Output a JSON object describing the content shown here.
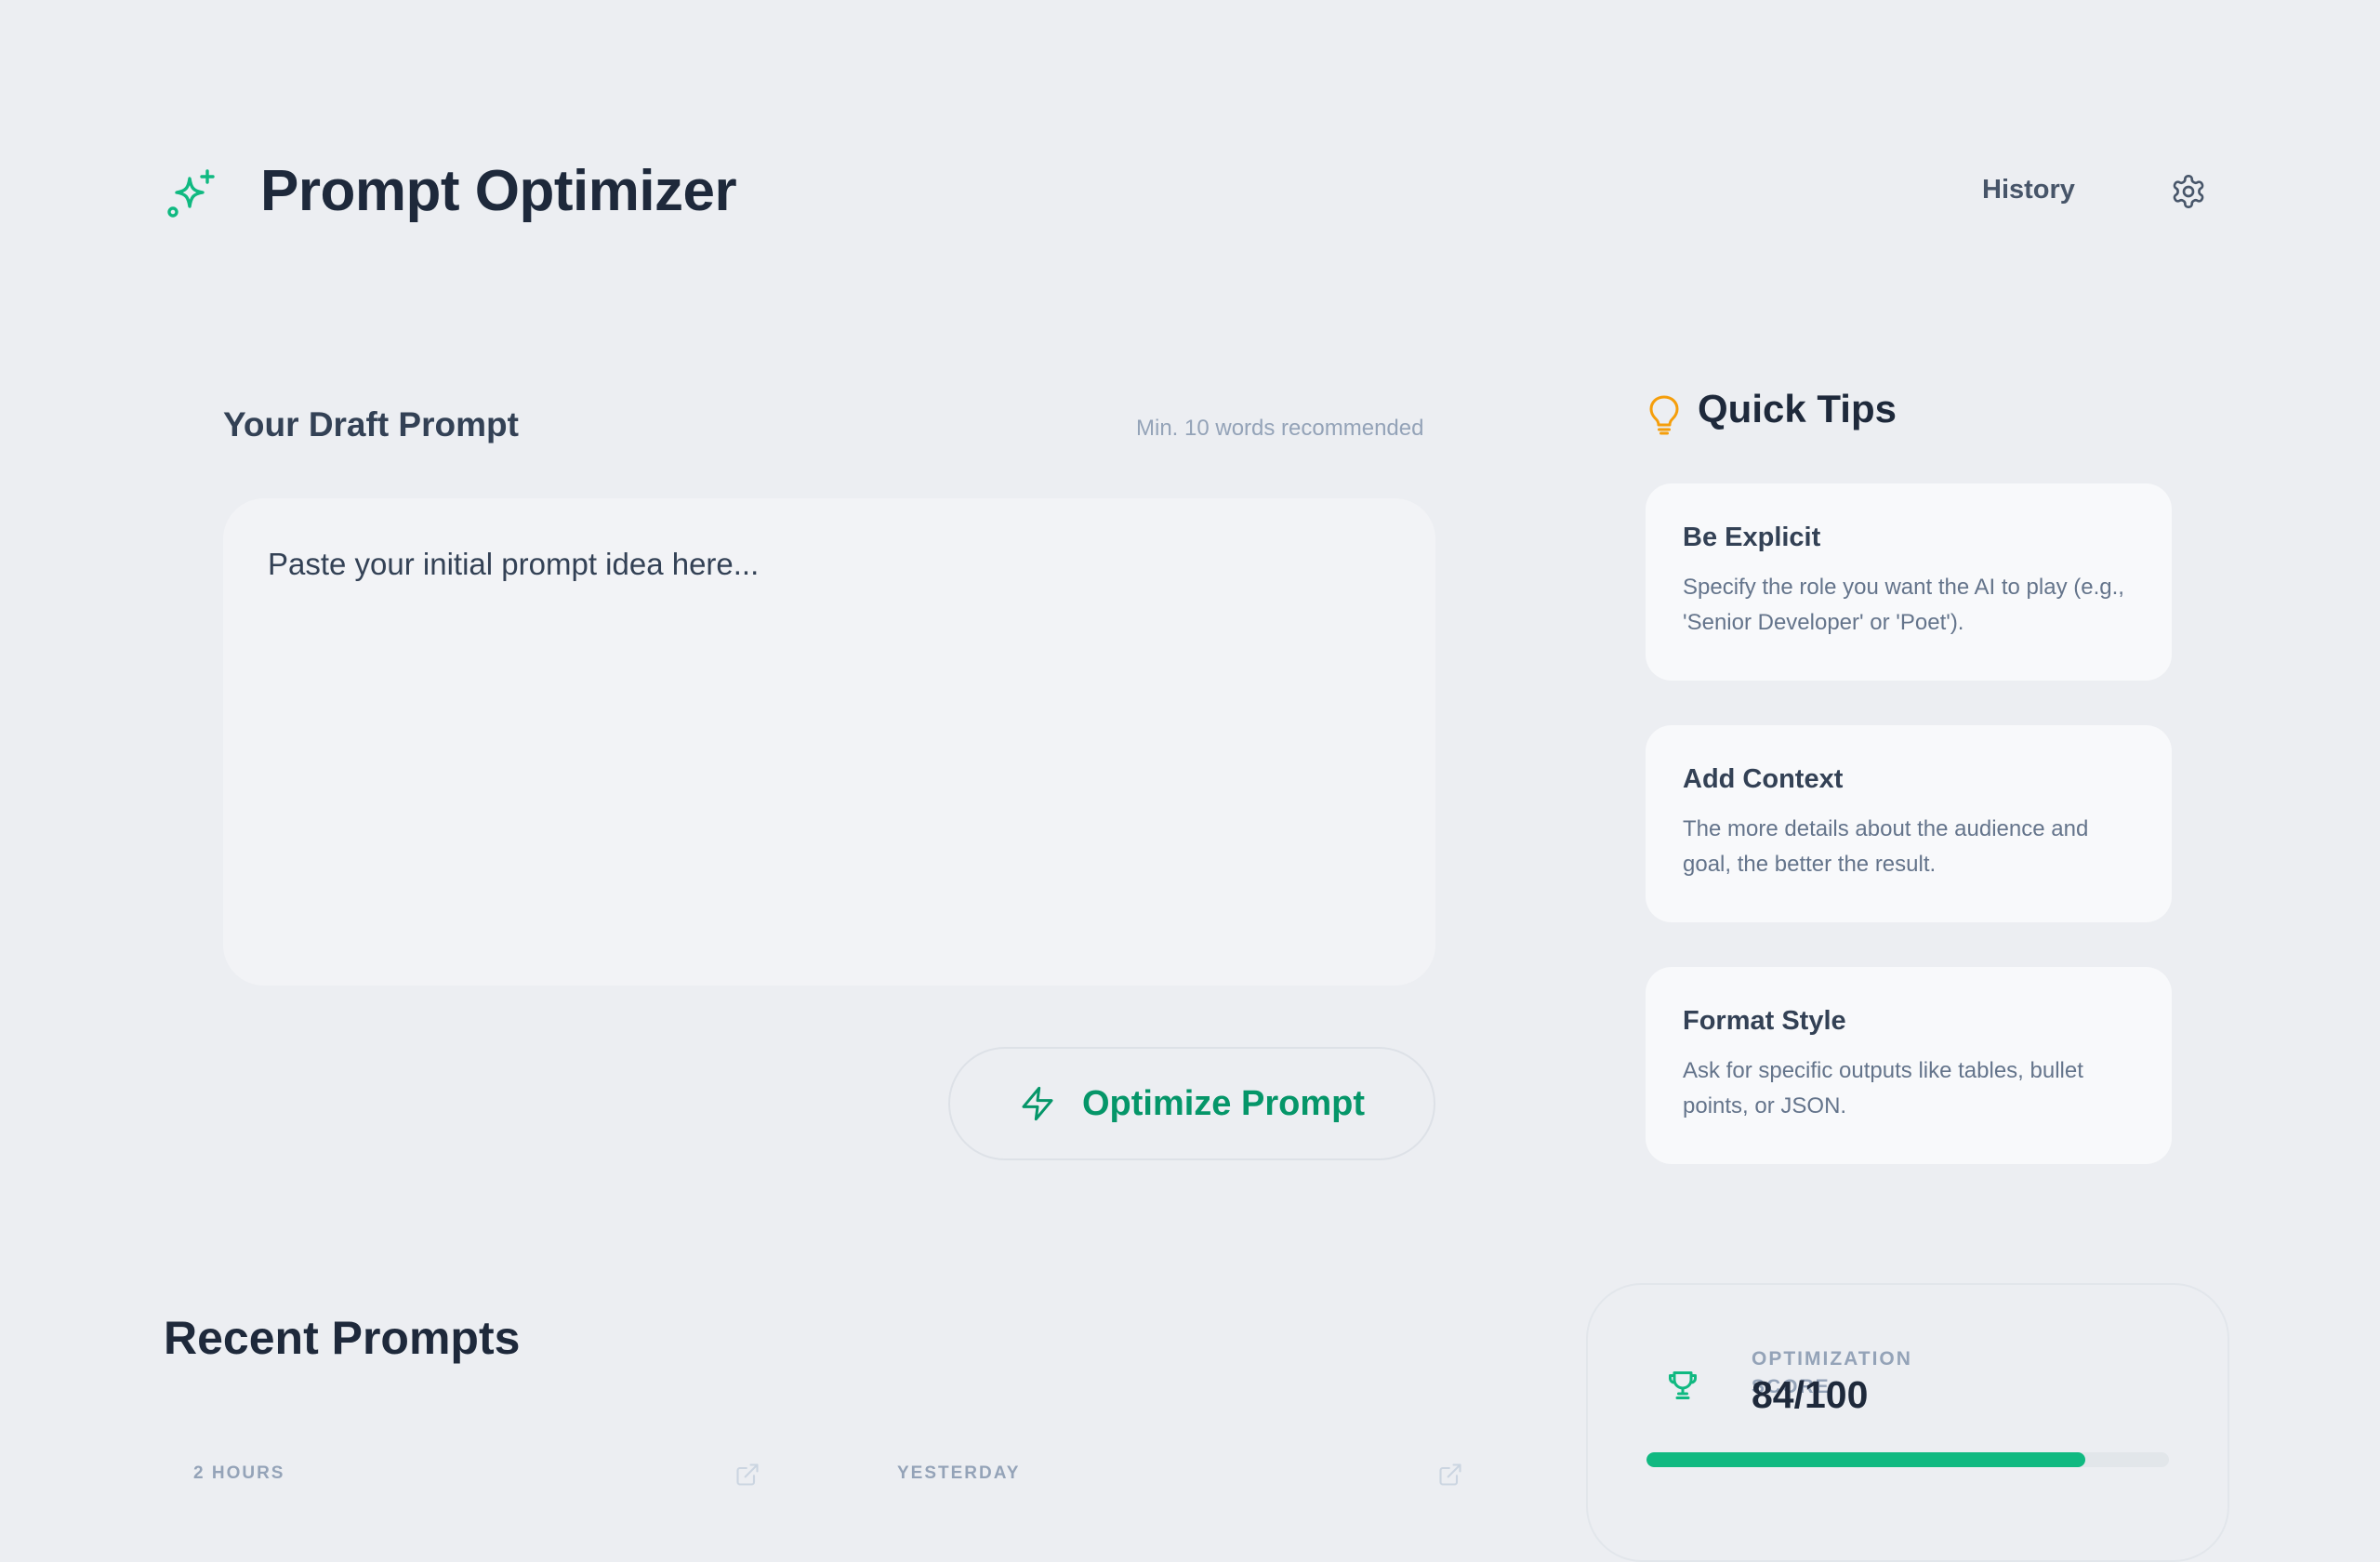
{
  "header": {
    "title": "Prompt Optimizer",
    "history_label": "History",
    "brand_icon": "sparkles-icon",
    "settings_icon": "gear-icon"
  },
  "draft": {
    "title": "Your Draft Prompt",
    "hint": "Min. 10 words recommended",
    "placeholder": "Paste your initial prompt idea here...",
    "value": ""
  },
  "optimize": {
    "label": "Optimize Prompt",
    "icon": "lightning-bolt-icon"
  },
  "tips": {
    "title": "Quick Tips",
    "icon": "lightbulb-icon",
    "items": [
      {
        "title": "Be Explicit",
        "desc": "Specify the role you want the AI to play (e.g., 'Senior Developer' or 'Poet')."
      },
      {
        "title": "Add Context",
        "desc": "The more details about the audience and goal, the better the result."
      },
      {
        "title": "Format Style",
        "desc": "Ask for specific outputs like tables, bullet points, or JSON."
      }
    ]
  },
  "recent": {
    "title": "Recent Prompts",
    "items": [
      {
        "time": "2 HOURS"
      },
      {
        "time": "YESTERDAY"
      }
    ]
  },
  "score": {
    "label": "OPTIMIZATION SCORE",
    "value": "84/100",
    "progress": 0.84,
    "icon": "trophy-icon"
  },
  "colors": {
    "accent": "#10b981",
    "accent_text": "#059669",
    "tips_icon": "#f59e0b",
    "background": "#eceef2"
  }
}
